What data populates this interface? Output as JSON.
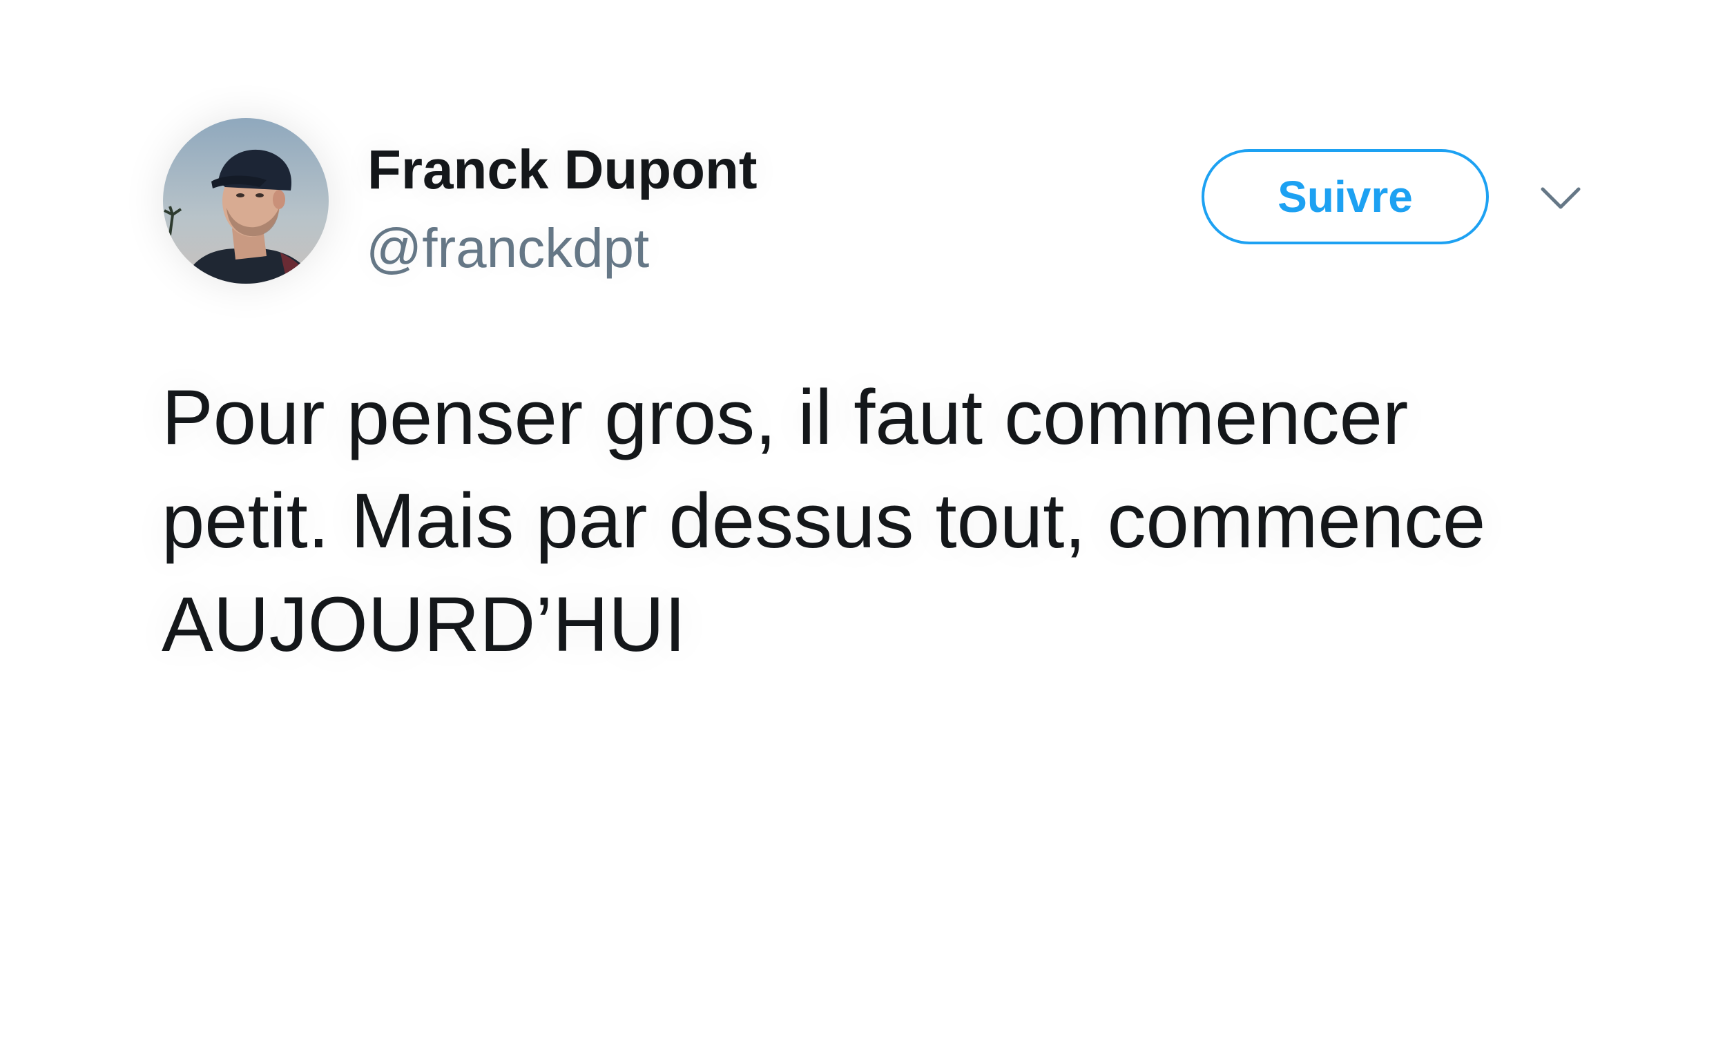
{
  "tweet": {
    "author": {
      "display_name": "Franck Dupont",
      "handle": "@franckdpt",
      "avatar_icon": "profile-photo"
    },
    "follow_button_label": "Suivre",
    "menu_icon": "chevron-down-icon",
    "text_lines": [
      "Pour penser gros, il faut commencer",
      "petit. Mais par dessus tout, commence",
      "AUJOURD’HUI"
    ]
  },
  "colors": {
    "accent": "#1da1f2",
    "text_primary": "#14171a",
    "text_secondary": "#657786",
    "background": "#ffffff"
  }
}
